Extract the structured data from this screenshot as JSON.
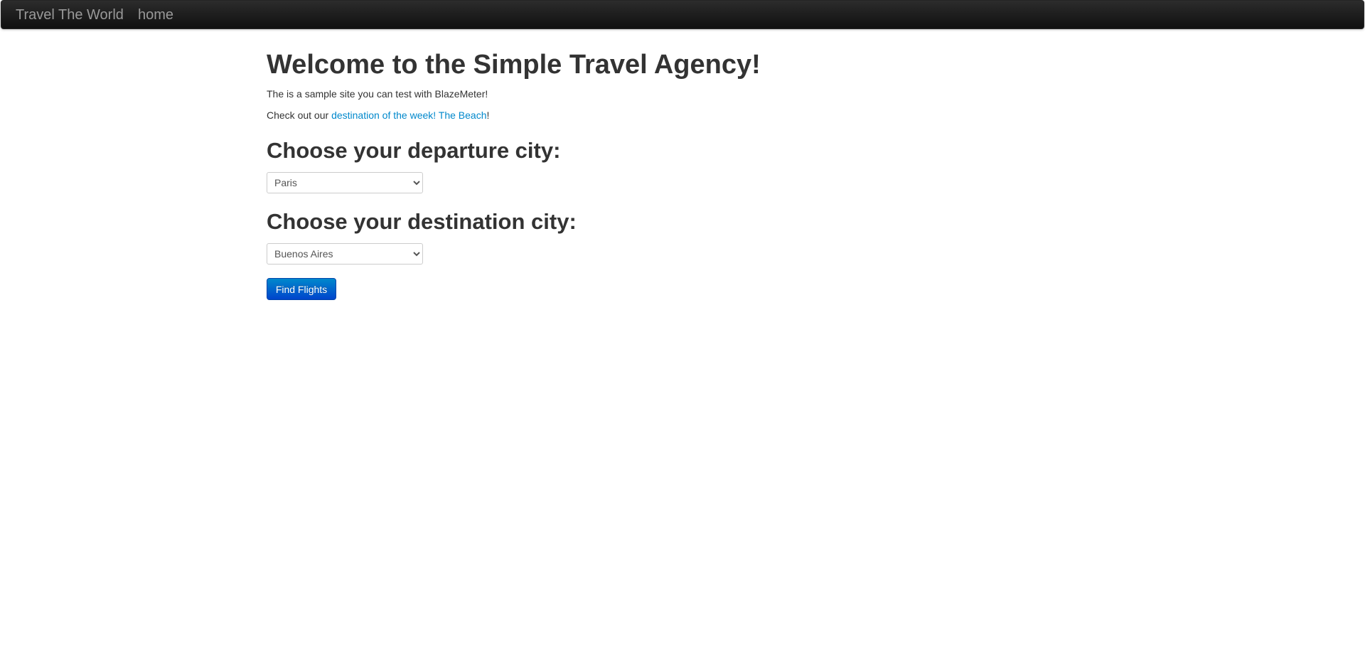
{
  "navbar": {
    "brand": "Travel The World",
    "home_link": "home"
  },
  "main": {
    "title": "Welcome to the Simple Travel Agency!",
    "intro": "The is a sample site you can test with BlazeMeter!",
    "promo_prefix": "Check out our ",
    "promo_link": "destination of the week! The Beach",
    "promo_suffix": "!",
    "departure_heading": "Choose your departure city:",
    "departure_selected": "Paris",
    "destination_heading": "Choose your destination city:",
    "destination_selected": "Buenos Aires",
    "find_button": "Find Flights"
  },
  "colors": {
    "navbar_bg": "#1b1b1b",
    "nav_text": "#999999",
    "link": "#0088cc",
    "button": "#0044cc"
  }
}
